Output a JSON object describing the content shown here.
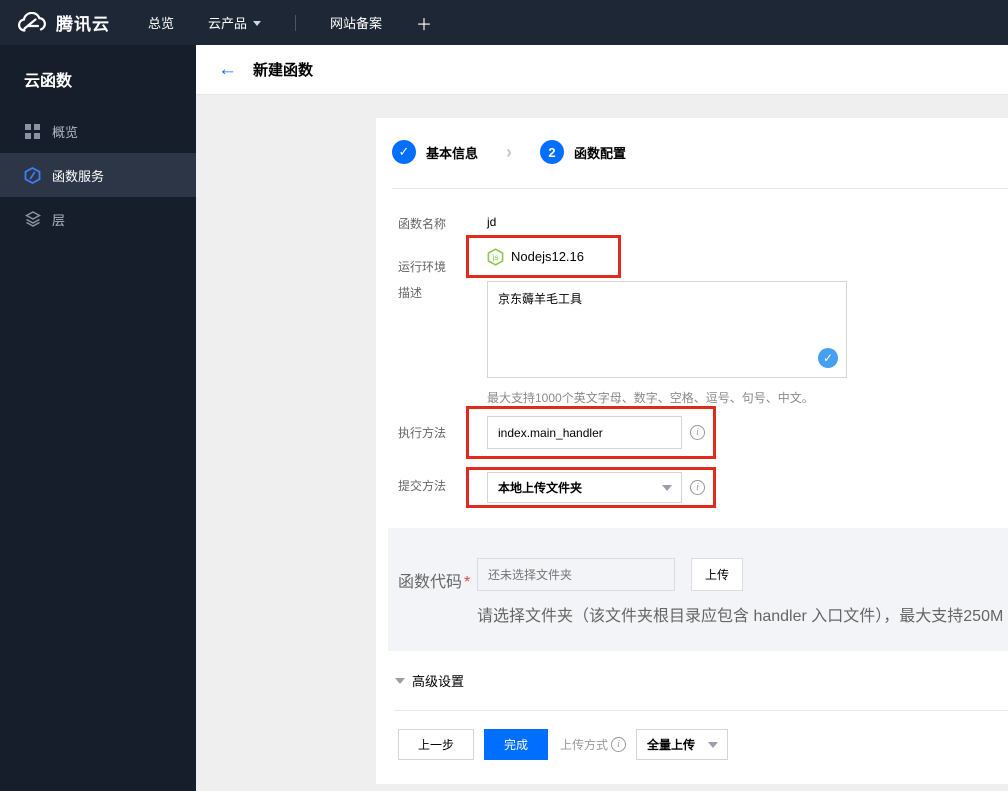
{
  "icons": {
    "back_arrow": "←",
    "check": "✓",
    "step_sep": "›",
    "info": "i",
    "nodejs_glyph": "js",
    "plus": "＋"
  },
  "topbar": {
    "brand": "腾讯云",
    "overview": "总览",
    "products": "云产品",
    "beian": "网站备案"
  },
  "sidebar": {
    "title": "云函数",
    "items": [
      {
        "label": "概览"
      },
      {
        "label": "函数服务"
      },
      {
        "label": "层"
      }
    ]
  },
  "header": {
    "title": "新建函数"
  },
  "steps": {
    "step1_label": "基本信息",
    "step2_num": "2",
    "step2_label": "函数配置"
  },
  "form": {
    "name_label": "函数名称",
    "name_value": "jd",
    "runtime_label": "运行环境",
    "runtime_value": "Nodejs12.16",
    "desc_label": "描述",
    "desc_value": "京东薅羊毛工具",
    "desc_hint": "最大支持1000个英文字母、数字、空格、逗号、句号、中文。",
    "handler_label": "执行方法",
    "handler_value": "index.main_handler",
    "submit_label": "提交方法",
    "submit_value": "本地上传文件夹"
  },
  "code": {
    "label": "函数代码",
    "required_mark": "*",
    "placeholder": "还未选择文件夹",
    "upload_button": "上传",
    "hint": "请选择文件夹（该文件夹根目录应包含 handler 入口文件），最大支持250M"
  },
  "advanced_label": "高级设置",
  "footer": {
    "prev": "上一步",
    "finish": "完成",
    "upload_mode_label": "上传方式",
    "upload_mode_value": "全量上传"
  },
  "colors": {
    "accent_blue": "#006eff",
    "badge_blue": "#459ff3",
    "annotation_red": "#e02b1c",
    "node_green": "#8cc84b",
    "topbar_bg": "#1e2736",
    "sidebar_bg": "#161d2b"
  }
}
